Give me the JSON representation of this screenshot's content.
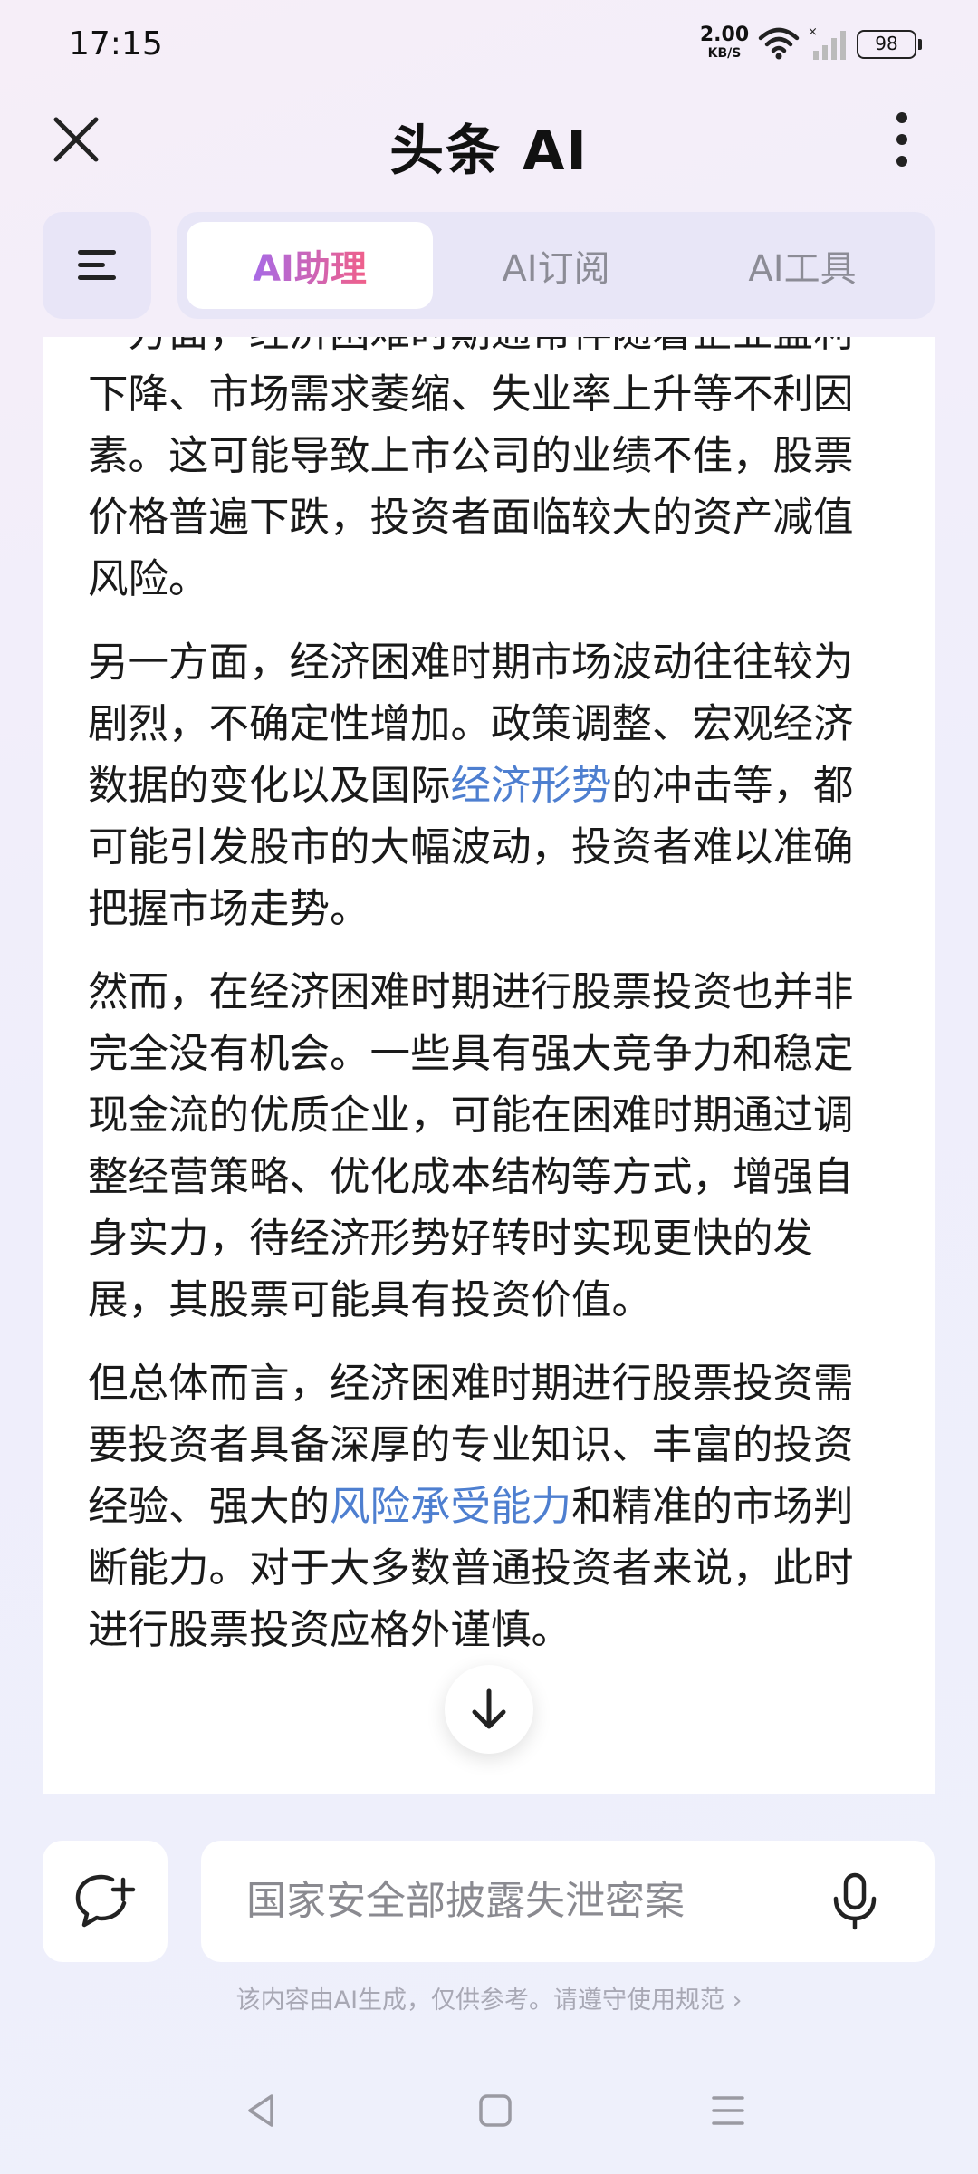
{
  "status_bar": {
    "time": "17:15",
    "net_speed_value": "2.00",
    "net_speed_unit": "KB/S",
    "battery": "98"
  },
  "header": {
    "title": "头条 AI"
  },
  "tabs": [
    {
      "label": "AI助理",
      "active": true
    },
    {
      "label": "AI订阅",
      "active": false
    },
    {
      "label": "AI工具",
      "active": false
    }
  ],
  "content": {
    "p1": "一方面，经济困难时期通常伴随着企业盈利下降、市场需求萎缩、失业率上升等不利因素。这可能导致上市公司的业绩不佳，股票价格普遍下跌，投资者面临较大的资产减值风险。",
    "p2_before": "另一方面，经济困难时期市场波动往往较为剧烈，不确定性增加。政策调整、宏观经济数据的变化以及国际",
    "p2_link": "经济形势",
    "p2_after": "的冲击等，都可能引发股市的大幅波动，投资者难以准确把握市场走势。",
    "p3": "然而，在经济困难时期进行股票投资也并非完全没有机会。一些具有强大竞争力和稳定现金流的优质企业，可能在困难时期通过调整经营策略、优化成本结构等方式，增强自身实力，待经济形势好转时实现更快的发展，其股票可能具有投资价值。",
    "p4_before": "但总体而言，经济困难时期进行股票投资需要投资者具备深厚的专业知识、丰富的投资经验、强大的",
    "p4_link": "风险承受能力",
    "p4_after": "和精准的市场判断能力。对于大多数普通投资者来说，此时进行股票投资应格外谨慎。"
  },
  "input": {
    "placeholder": "国家安全部披露失泄密案"
  },
  "disclaimer": "该内容由AI生成，仅供参考。请遵守使用规范 ›",
  "colors": {
    "link": "#4e7fd0",
    "tab_active_gradient_start": "#a76ae6",
    "tab_active_gradient_end": "#f0608a",
    "tab_inactive": "#8c8c96"
  }
}
